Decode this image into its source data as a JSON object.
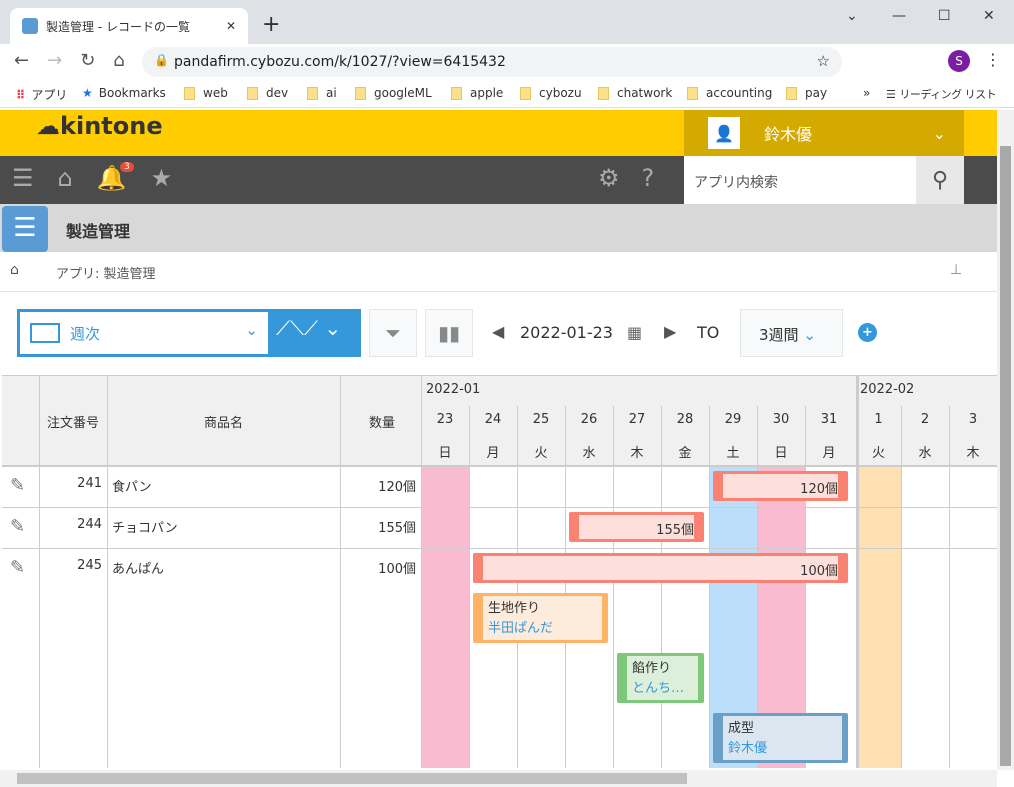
{
  "browser": {
    "tab_title": "製造管理 - レコードの一覧",
    "url": "pandafirm.cybozu.com/k/1027/?view=6415432",
    "profile_initial": "S",
    "bookmarks": [
      "アプリ",
      "Bookmarks",
      "web",
      "dev",
      "ai",
      "googleML",
      "apple",
      "cybozu",
      "chatwork",
      "accounting",
      "pay"
    ],
    "reading_list": "リーディング リスト"
  },
  "header": {
    "logo": "kintone",
    "user": "鈴木優",
    "notification_count": "3",
    "search_placeholder": "アプリ内検索"
  },
  "app": {
    "title": "製造管理",
    "breadcrumb": "アプリ: 製造管理"
  },
  "toolbar": {
    "view": "週次",
    "date": "2022-01-23",
    "to": "TO",
    "span": "3週間"
  },
  "table": {
    "columns": [
      "注文番号",
      "商品名",
      "数量"
    ],
    "months": [
      "2022-01",
      "2022-02"
    ],
    "days": [
      [
        "23",
        "日"
      ],
      [
        "24",
        "月"
      ],
      [
        "25",
        "火"
      ],
      [
        "26",
        "水"
      ],
      [
        "27",
        "木"
      ],
      [
        "28",
        "金"
      ],
      [
        "29",
        "土"
      ],
      [
        "30",
        "日"
      ],
      [
        "31",
        "月"
      ],
      [
        "1",
        "火"
      ],
      [
        "2",
        "水"
      ],
      [
        "3",
        "木"
      ]
    ],
    "rows": [
      {
        "no": "241",
        "name": "食パン",
        "qty": "120個",
        "bar": "120個"
      },
      {
        "no": "244",
        "name": "チョコパン",
        "qty": "155個",
        "bar": "155個"
      },
      {
        "no": "245",
        "name": "あんぱん",
        "qty": "100個",
        "bar": "100個"
      }
    ],
    "tasks": [
      {
        "name": "生地作り",
        "who": "半田ぱんだ",
        "color": "#ffb366"
      },
      {
        "name": "餡作り",
        "who": "とんち…",
        "color": "#7dc87a"
      },
      {
        "name": "成型",
        "who": "鈴木優",
        "color": "#6a9fc8"
      }
    ]
  },
  "colors": {
    "sunday": "#f8bbd0",
    "saturday": "#bbdefb",
    "holiday": "#ffe0b2",
    "accent": "#3498db",
    "header": "#ffcc00"
  }
}
